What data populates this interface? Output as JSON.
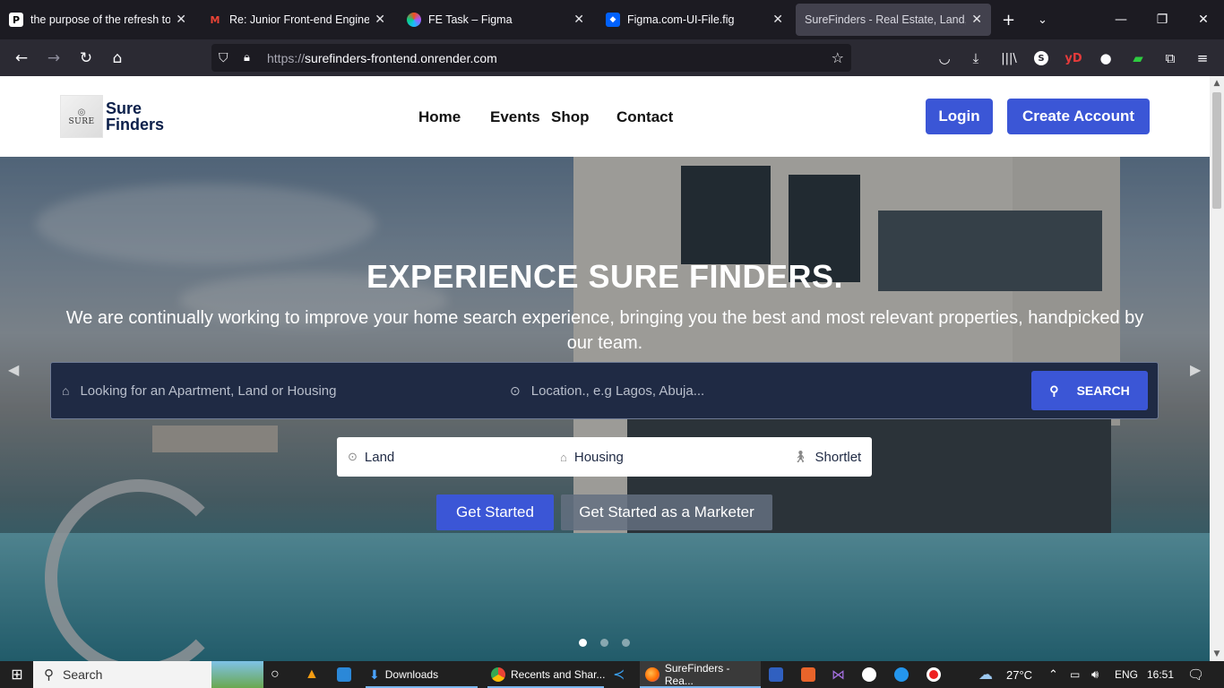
{
  "browser": {
    "tabs": [
      {
        "title": "the purpose of the refresh toke",
        "favicon": "P"
      },
      {
        "title": "Re: Junior Front-end Engineerin",
        "favicon": "M"
      },
      {
        "title": "FE Task – Figma",
        "favicon": ""
      },
      {
        "title": "Figma.com-UI-File.fig",
        "favicon": ""
      },
      {
        "title": "SureFinders - Real Estate, Land, and",
        "favicon": ""
      }
    ],
    "url_protocol": "https://",
    "url_host": "surefinders-frontend.onrender.com"
  },
  "site": {
    "logo_line1": "Sure",
    "logo_line2": "Finders",
    "logo_word": "SURE",
    "nav": [
      "Home",
      "Events",
      "Shop",
      "Contact"
    ],
    "login": "Login",
    "create_account": "Create Account"
  },
  "hero": {
    "title": "EXPERIENCE SURE FINDERS.",
    "subtitle": "We are continually working to improve your home search experience, bringing you the best and most relevant properties, handpicked by our team.",
    "search_placeholder": "Looking for an Apartment, Land or Housing",
    "location_placeholder": "Location., e.g Lagos, Abuja...",
    "search_button": "SEARCH",
    "categories": [
      "Land",
      "Housing",
      "Shortlet"
    ],
    "get_started": "Get Started",
    "get_started_marketer": "Get Started as a Marketer",
    "slide_count": 3,
    "active_slide": 1
  },
  "taskbar": {
    "search": "Search",
    "downloads": "Downloads",
    "chrome_window": "Recents and Shar...",
    "firefox_window": "SureFinders - Rea...",
    "temperature": "27°C",
    "language": "ENG",
    "time": "16:51"
  }
}
